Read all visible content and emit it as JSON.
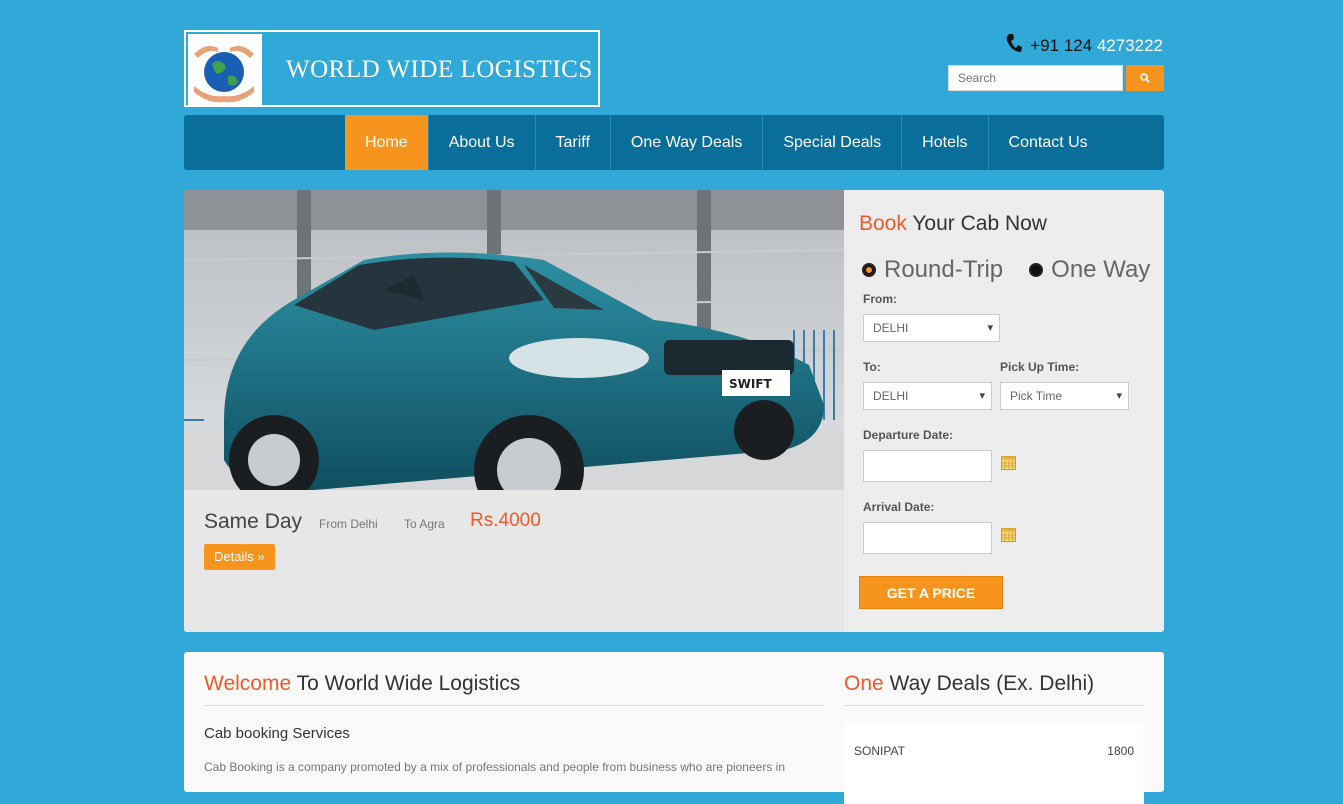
{
  "header": {
    "logo_title": "WORLD WIDE LOGISTICS",
    "phone_main": "+91 124",
    "phone_ext": "4273222",
    "search_placeholder": "Search"
  },
  "nav": {
    "items": [
      {
        "label": "Home",
        "active": true
      },
      {
        "label": "About Us"
      },
      {
        "label": "Tariff"
      },
      {
        "label": "One Way Deals"
      },
      {
        "label": "Special Deals"
      },
      {
        "label": "Hotels"
      },
      {
        "label": "Contact Us"
      }
    ]
  },
  "hero": {
    "plate_text": "SWIFT",
    "caption": {
      "title": "Same Day",
      "from": "From Delhi",
      "to": "To Agra",
      "price": "Rs.4000",
      "details_label": "Details »"
    }
  },
  "booking": {
    "title_highlight": "Book",
    "title_rest": "Your Cab Now",
    "radio_round_trip": "Round-Trip",
    "radio_one_way": "One Way",
    "from_label": "From:",
    "from_value": "DELHI",
    "to_label": "To:",
    "to_value": "DELHI",
    "pickup_label": "Pick Up Time:",
    "pickup_value": "Pick Time",
    "departure_label": "Departure Date:",
    "arrival_label": "Arrival Date:",
    "submit_label": "GET A PRICE"
  },
  "content": {
    "welcome_highlight": "Welcome",
    "welcome_rest": "To World Wide Logistics",
    "services_title": "Cab booking Services",
    "paragraph": "Cab Booking is a company promoted by a mix of professionals and people from business who are pioneers in",
    "deals_highlight": "One",
    "deals_rest": "Way Deals (Ex. Delhi)",
    "deals": [
      {
        "city": "SONIPAT",
        "price": "1800"
      }
    ]
  },
  "colors": {
    "background": "#31a9d8",
    "nav": "#0a6e9a",
    "accent": "#f7941d",
    "highlight": "#f05a28"
  }
}
